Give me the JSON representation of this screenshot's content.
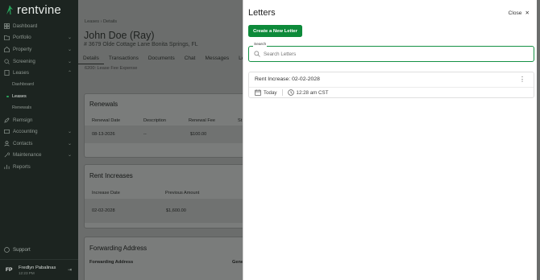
{
  "app": {
    "brand": "rentvine",
    "brand_color": "#27a35a"
  },
  "sidebar": {
    "items": [
      {
        "label": "Dashboard",
        "icon": "dashboard-icon",
        "chevron": false
      },
      {
        "label": "Portfolio",
        "icon": "folder-icon",
        "chevron": true
      },
      {
        "label": "Property",
        "icon": "property-icon",
        "chevron": true
      },
      {
        "label": "Screening",
        "icon": "screening-icon",
        "chevron": true
      },
      {
        "label": "Leases",
        "icon": "leases-icon",
        "chevron": true
      }
    ],
    "sub_items": [
      {
        "label": "Dashboard"
      },
      {
        "label": "Leases"
      },
      {
        "label": "Renewals"
      }
    ],
    "items2": [
      {
        "label": "Remsign",
        "icon": "pen-icon",
        "chevron": false
      },
      {
        "label": "Accounting",
        "icon": "accounting-icon",
        "chevron": true
      },
      {
        "label": "Contacts",
        "icon": "contacts-icon",
        "chevron": true
      },
      {
        "label": "Maintenance",
        "icon": "wrench-icon",
        "chevron": true
      },
      {
        "label": "Reports",
        "icon": "reports-icon",
        "chevron": false
      }
    ],
    "support": "Support",
    "user": {
      "initials": "FP",
      "name": "Fredlyn Pabalinas",
      "time": "12:23 PM"
    }
  },
  "main": {
    "breadcrumb": "Leases  ›  Details",
    "title": "John Doe (Ray)",
    "address": "3679 Olde Cottage Lane Bonita Springs, FL",
    "tabs": [
      "Details",
      "Transactions",
      "Documents",
      "Chat",
      "Messages",
      "Ledger"
    ],
    "cut_line": "6200: Lease Fee Expense",
    "renewals": {
      "title": "Renewals",
      "headers": [
        "Renewal Date",
        "Description",
        "Renewal Fee",
        "St"
      ],
      "row": [
        "08-13-2026",
        "--",
        "$100.00",
        ""
      ]
    },
    "rent_increases": {
      "title": "Rent Increases",
      "headers": [
        "Increase Date",
        "Previous Amount"
      ],
      "row": [
        "02-02-2028",
        "$1,600.00"
      ]
    },
    "forwarding": {
      "title": "Forwarding Address",
      "headers": [
        "Forwarding Address",
        "Gene"
      ]
    }
  },
  "panel": {
    "title": "Letters",
    "close_label": "Close",
    "create_button": "Create a New Letter",
    "search_label": "Search",
    "search_placeholder": "Search Letters",
    "letters": [
      {
        "title": "Rent Increase: 02-02-2028",
        "date": "Today",
        "time": "12:28 am CST"
      }
    ],
    "accent": "#0d8a3a"
  }
}
